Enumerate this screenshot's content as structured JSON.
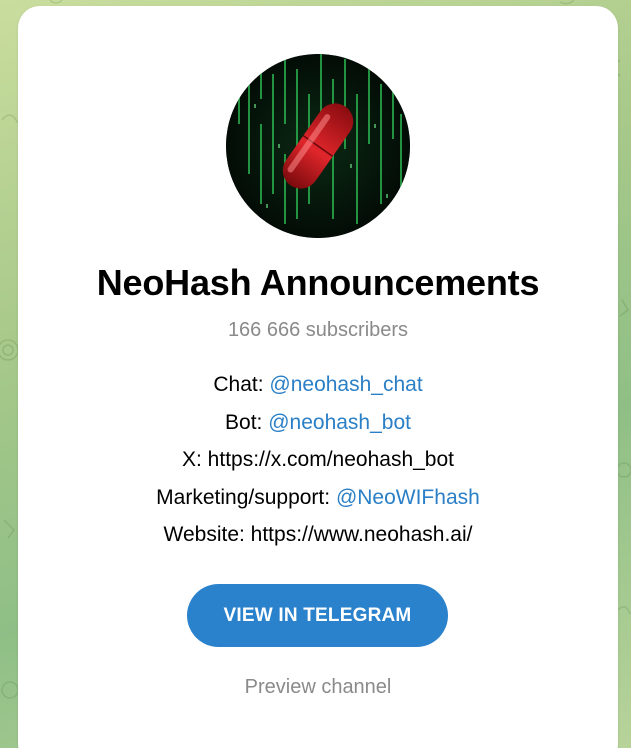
{
  "channel": {
    "title": "NeoHash Announcements",
    "subscribers": "166 666 subscribers",
    "avatar_icon": "red-pill-matrix-avatar"
  },
  "description": {
    "chat_label": "Chat:",
    "chat_link": "@neohash_chat",
    "bot_label": "Bot:",
    "bot_link": "@neohash_bot",
    "x_text": "X: https://x.com/neohash_bot",
    "marketing_label": "Marketing/support:",
    "marketing_link": "@NeoWIFhash",
    "website_text": "Website: https://www.neohash.ai/"
  },
  "actions": {
    "view_button": "VIEW IN TELEGRAM",
    "preview_link": "Preview channel"
  },
  "colors": {
    "accent": "#2b82cc",
    "link": "#2a7fc6",
    "muted": "#8a8a8a",
    "pill_red": "#c4161c"
  }
}
